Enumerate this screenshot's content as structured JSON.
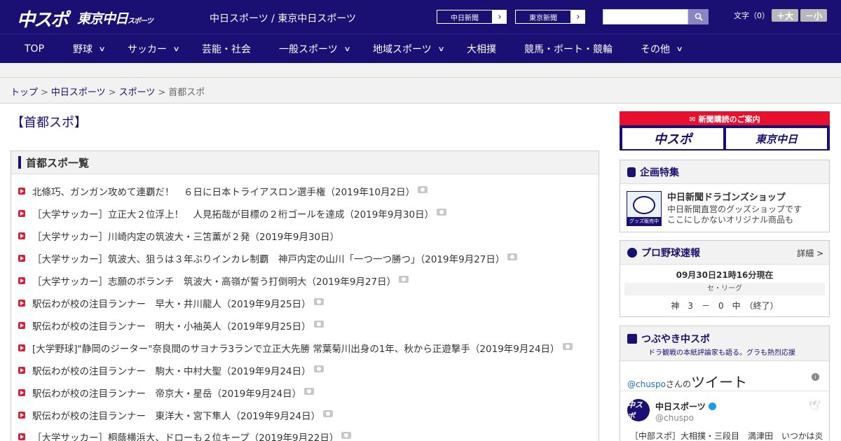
{
  "header": {
    "logo_chuspo": "中スポ",
    "logo_tokyo": "東京中日",
    "logo_tokyo_small": "スポーツ",
    "site_names": "中日スポーツ / 東京中日スポーツ",
    "btn_chunichi": "中日新聞",
    "btn_tokyo": "東京新聞",
    "search_placeholder": "",
    "fontsize_label": "文字（0）",
    "fontsize_large": "＋大",
    "fontsize_small": "－小"
  },
  "nav": [
    {
      "label": "TOP",
      "dropdown": false
    },
    {
      "label": "野球",
      "dropdown": true
    },
    {
      "label": "サッカー",
      "dropdown": true
    },
    {
      "label": "芸能・社会",
      "dropdown": false
    },
    {
      "label": "一般スポーツ",
      "dropdown": true
    },
    {
      "label": "地域スポーツ",
      "dropdown": true
    },
    {
      "label": "大相撲",
      "dropdown": false
    },
    {
      "label": "競馬・ボート・競輪",
      "dropdown": false
    },
    {
      "label": "その他",
      "dropdown": true
    }
  ],
  "breadcrumb": {
    "top": "トップ",
    "chunichi": "中日スポーツ",
    "sports": "スポーツ",
    "current": "首都スポ",
    "sep": ">"
  },
  "page_title": "【首都スポ】",
  "list": {
    "heading": "首都スポ一覧",
    "articles": [
      {
        "text": "北條巧、ガンガン攻めて連覇だ！　６日に日本トライアスロン選手権（2019年10月2日）",
        "photo": true
      },
      {
        "text": "［大学サッカー］立正大２位浮上！　人見拓哉が目標の２桁ゴールを達成（2019年9月30日）",
        "photo": true
      },
      {
        "text": "［大学サッカー］川崎内定の筑波大・三笘薫が２発（2019年9月30日）",
        "photo": false
      },
      {
        "text": "［大学サッカー］筑波大、狙うは３年ぶりインカレ制覇　神戸内定の山川「一つ一つ勝つ」（2019年9月27日）",
        "photo": true
      },
      {
        "text": "［大学サッカー］志願のボランチ　筑波大・高嶺が誓う打倒明大（2019年9月27日）",
        "photo": true
      },
      {
        "text": "駅伝わが校の注目ランナー　早大・井川龍人（2019年9月25日）",
        "photo": true
      },
      {
        "text": "駅伝わが校の注目ランナー　明大・小袖英人（2019年9月25日）",
        "photo": true
      },
      {
        "text": "[大学野球]\"静岡のジーター\"奈良間のサヨナラ3ランで立正大先勝 常葉菊川出身の1年、秋から正遊撃手（2019年9月24日）",
        "photo": true
      },
      {
        "text": "駅伝わが校の注目ランナー　駒大・中村大聖（2019年9月24日）",
        "photo": true
      },
      {
        "text": "駅伝わが校の注目ランナー　帝京大・星岳（2019年9月24日）",
        "photo": true
      },
      {
        "text": "駅伝わが校の注目ランナー　東洋大・宮下隼人（2019年9月24日）",
        "photo": true
      },
      {
        "text": "［大学サッカー］桐蔭横浜大、ドローも２位キープ（2019年9月22日）",
        "photo": true
      }
    ]
  },
  "sidebar": {
    "subscribe_head": "新聞購読のご案内",
    "subscribe_logo1": "中スポ",
    "subscribe_logo2": "東京中日",
    "kikaku_head": "企画特集",
    "goods_tag": "グッズ販売中",
    "goods_title": "中日新聞ドラゴンズショップ",
    "goods_desc1": "中日新聞直営のグッズショップです",
    "goods_desc2": "ここにしかないオリジナル商品も",
    "baseball_head": "プロ野球速報",
    "baseball_detail": "詳細 >",
    "baseball_time": "09月30日21時16分現在",
    "baseball_league": "セ・リーグ",
    "baseball_score": "神　3　－　0　中　（終了）",
    "tweet_head": "つぶやき中スポ",
    "tweet_sub": "ドラ観戦の本紙評論家も語る。グラも熱烈応援",
    "tweet_user_handle": "@chuspo",
    "tweet_user_suffix": "さんの",
    "tweet_user_big": "ツイート",
    "tweet_name": "中日スポーツ",
    "tweet_screen": "@chuspo",
    "tweet_text": "［中部スポ］大相撲・三段目　満津田　いつかは炎"
  }
}
